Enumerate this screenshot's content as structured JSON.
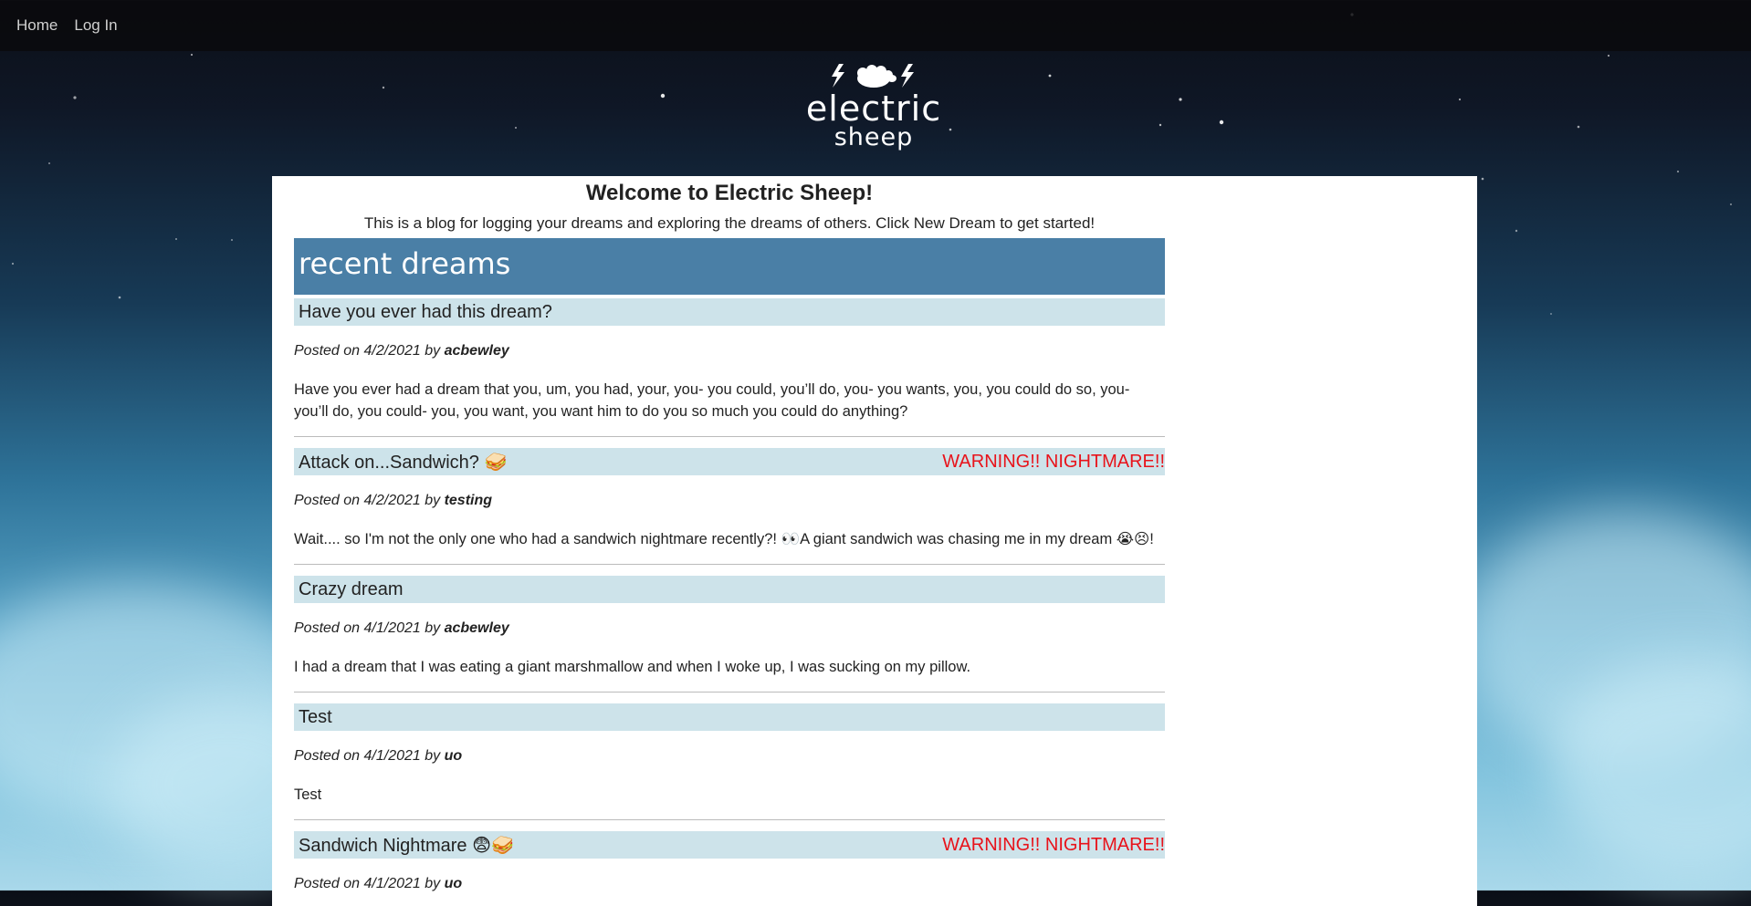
{
  "nav": {
    "home": "Home",
    "login": "Log In"
  },
  "logo": {
    "line1": "electric",
    "line2": "sheep"
  },
  "welcome": {
    "title": "Welcome to Electric Sheep!",
    "intro": "This is a blog for logging your dreams and exploring the dreams of others. Click New Dream to get started!"
  },
  "recent": {
    "heading": "recent dreams"
  },
  "posts": [
    {
      "title": "Have you ever had this dream?",
      "warning": "",
      "posted_prefix": "Posted on 4/2/2021 by",
      "author": "acbewley",
      "body": "Have you ever had a dream that you, um, you had, your, you- you could, you’ll do, you- you wants, you, you could do so, you- you’ll do, you could- you, you want, you want him to do you so much you could do anything?"
    },
    {
      "title": "Attack on...Sandwich? 🥪",
      "warning": "WARNING!! NIGHTMARE!!",
      "posted_prefix": "Posted on 4/2/2021 by",
      "author": "testing",
      "body": "Wait.... so I'm not the only one who had a sandwich nightmare recently?! 👀A giant sandwich was chasing me in my dream 😭😣!"
    },
    {
      "title": "Crazy dream",
      "warning": "",
      "posted_prefix": "Posted on 4/1/2021 by",
      "author": "acbewley",
      "body": "I had a dream that I was eating a giant marshmallow and when I woke up, I was sucking on my pillow."
    },
    {
      "title": "Test",
      "warning": "",
      "posted_prefix": "Posted on 4/1/2021 by",
      "author": "uo",
      "body": "Test"
    },
    {
      "title": "Sandwich Nightmare 😨🥪",
      "warning": "WARNING!! NIGHTMARE!!",
      "posted_prefix": "Posted on 4/1/2021 by",
      "author": "uo",
      "body": ""
    }
  ],
  "colors": {
    "header_blue": "#4a7fa6",
    "title_bar": "#cde3ea",
    "warning_red": "#e8131b"
  }
}
